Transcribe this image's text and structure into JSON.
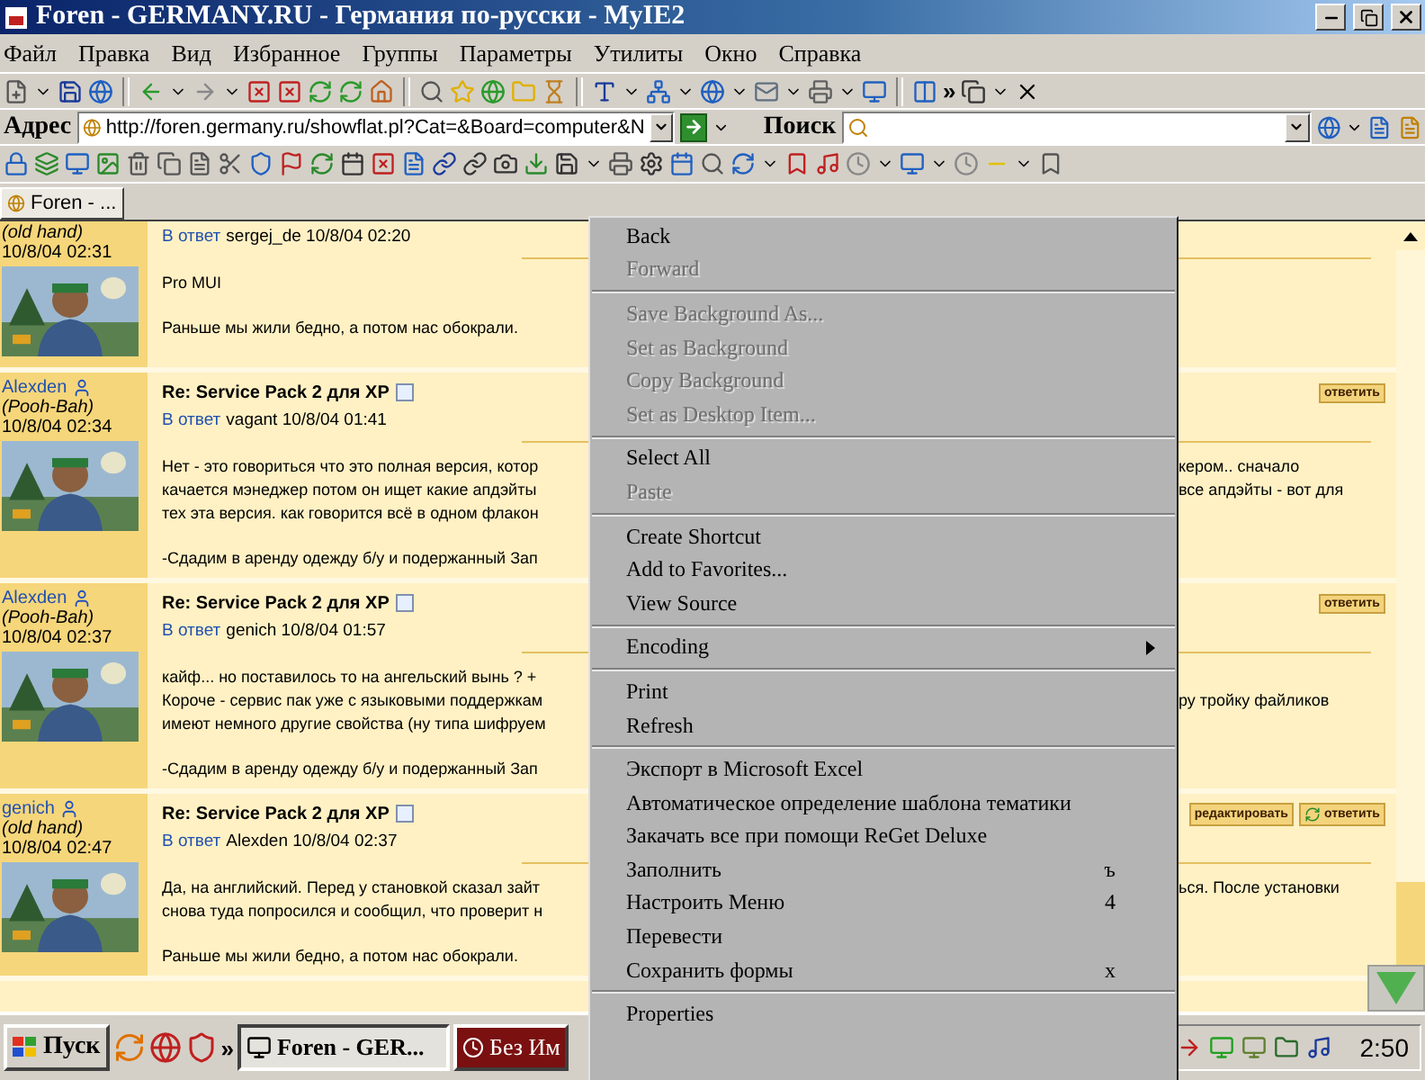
{
  "window": {
    "title": "Foren - GERMANY.RU - Германия по-русски - MyIE2"
  },
  "menu": [
    "Файл",
    "Правка",
    "Вид",
    "Избранное",
    "Группы",
    "Параметры",
    "Утилиты",
    "Окно",
    "Справка"
  ],
  "toolbar": {
    "overflow": "»"
  },
  "address_bar": {
    "label": "Адрес",
    "value": "http://foren.germany.ru/showflat.pl?Cat=&Board=computer&N",
    "search_label": "Поиск"
  },
  "tabs": [
    {
      "label": "Foren - ...",
      "selected": true
    }
  ],
  "posts": [
    {
      "rank": "(old hand)",
      "date": "10/8/04 02:31",
      "avatar": {
        "kind": "picture"
      },
      "reply_label": "В ответ",
      "reply_to": "sergej_de 10/8/04 02:20",
      "paragraphs": [
        [
          {
            "left": "Pro MUI"
          }
        ],
        [
          {
            "left": "Раньше мы жили бедно, а потом нас обокрали."
          }
        ]
      ]
    },
    {
      "author": "Alexden",
      "rank": "(Pooh-Bah)",
      "date": "10/8/04 02:34",
      "avatar": {
        "kind": "picture"
      },
      "title": "Re: Service Pack 2 для XP",
      "actions": [
        "ответить"
      ],
      "reply_label": "В ответ",
      "reply_to": "vagant 10/8/04 01:41",
      "paragraphs": [
        [
          {
            "left": "Нет - это говориться что это полная версия, котор",
            "right": "кером.. сначало"
          },
          {
            "left": "качается мэнеджер потом он ищет какие апдэйты",
            "right": "все апдэйты - вот для"
          },
          {
            "left": "тех эта версия. как говорится всё в одном флакон"
          }
        ],
        [
          {
            "left": "-Сдадим в аренду одежду б/у и подержанный Зап"
          }
        ]
      ]
    },
    {
      "author": "Alexden",
      "rank": "(Pooh-Bah)",
      "date": "10/8/04 02:37",
      "avatar": {
        "kind": "picture"
      },
      "title": "Re: Service Pack 2 для XP",
      "actions": [
        "ответить"
      ],
      "reply_label": "В ответ",
      "reply_to": "genich 10/8/04 01:57",
      "paragraphs": [
        [
          {
            "left": "кайф... но поставилось то на ангельский вынь ? +"
          },
          {
            "left": "Короче - сервис пак уже с языковыми поддержкам",
            "right": "ру тройку файликов"
          },
          {
            "left": "имеют немного другие свойства (ну типа шифруем"
          }
        ],
        [
          {
            "left": "-Сдадим в аренду одежду б/у и подержанный Зап"
          }
        ]
      ]
    },
    {
      "author": "genich",
      "rank": "(old hand)",
      "date": "10/8/04 02:47",
      "avatar": {
        "kind": "picture"
      },
      "title": "Re: Service Pack 2 для XP",
      "actions": [
        "редактировать",
        "ответить"
      ],
      "reply_label": "В ответ",
      "reply_to": "Alexden 10/8/04 02:37",
      "paragraphs": [
        [
          {
            "left": "Да, на английский. Перед у становкой сказал зайт",
            "right": "ься. После установки"
          },
          {
            "left": "снова туда попросился и сообщил, что проверит н"
          }
        ],
        [
          {
            "left": "Раньше мы жили бедно, а потом нас обокрали."
          }
        ]
      ]
    }
  ],
  "context_menu": {
    "groups": [
      [
        {
          "label": "Back",
          "disabled": false
        },
        {
          "label": "Forward",
          "disabled": true
        }
      ],
      [
        {
          "label": "Save Background As...",
          "disabled": true
        },
        {
          "label": "Set as Background",
          "disabled": true
        },
        {
          "label": "Copy Background",
          "disabled": true
        },
        {
          "label": "Set as Desktop Item...",
          "disabled": true
        }
      ],
      [
        {
          "label": "Select All",
          "disabled": false
        },
        {
          "label": "Paste",
          "disabled": true
        }
      ],
      [
        {
          "label": "Create Shortcut",
          "disabled": false
        },
        {
          "label": "Add to Favorites...",
          "disabled": false
        },
        {
          "label": "View Source",
          "disabled": false
        }
      ],
      [
        {
          "label": "Encoding",
          "disabled": false,
          "submenu": true
        }
      ],
      [
        {
          "label": "Print",
          "disabled": false
        },
        {
          "label": "Refresh",
          "disabled": false
        }
      ],
      [
        {
          "label": "Экспорт в Microsoft Excel",
          "disabled": false
        },
        {
          "label": "Автоматическое определение шаблона тематики",
          "disabled": false
        },
        {
          "label": "Закачать все при помощи ReGet Deluxe",
          "disabled": false
        },
        {
          "label": "Заполнить",
          "disabled": false,
          "shortcut": "ъ"
        },
        {
          "label": "Настроить Меню",
          "disabled": false,
          "shortcut": "4"
        },
        {
          "label": "Перевести",
          "disabled": false
        },
        {
          "label": "Сохранить формы",
          "disabled": false,
          "shortcut": "x"
        }
      ],
      [
        {
          "label": "Properties",
          "disabled": false
        }
      ]
    ]
  },
  "taskbar": {
    "start": "Пуск",
    "overflow": "»",
    "tasks": [
      {
        "label": "Foren - GER...",
        "selected": true,
        "color": "#e4e2dc"
      },
      {
        "label": "Без Им",
        "selected": false,
        "color": "#7a1010"
      }
    ],
    "clock": "2:50"
  }
}
